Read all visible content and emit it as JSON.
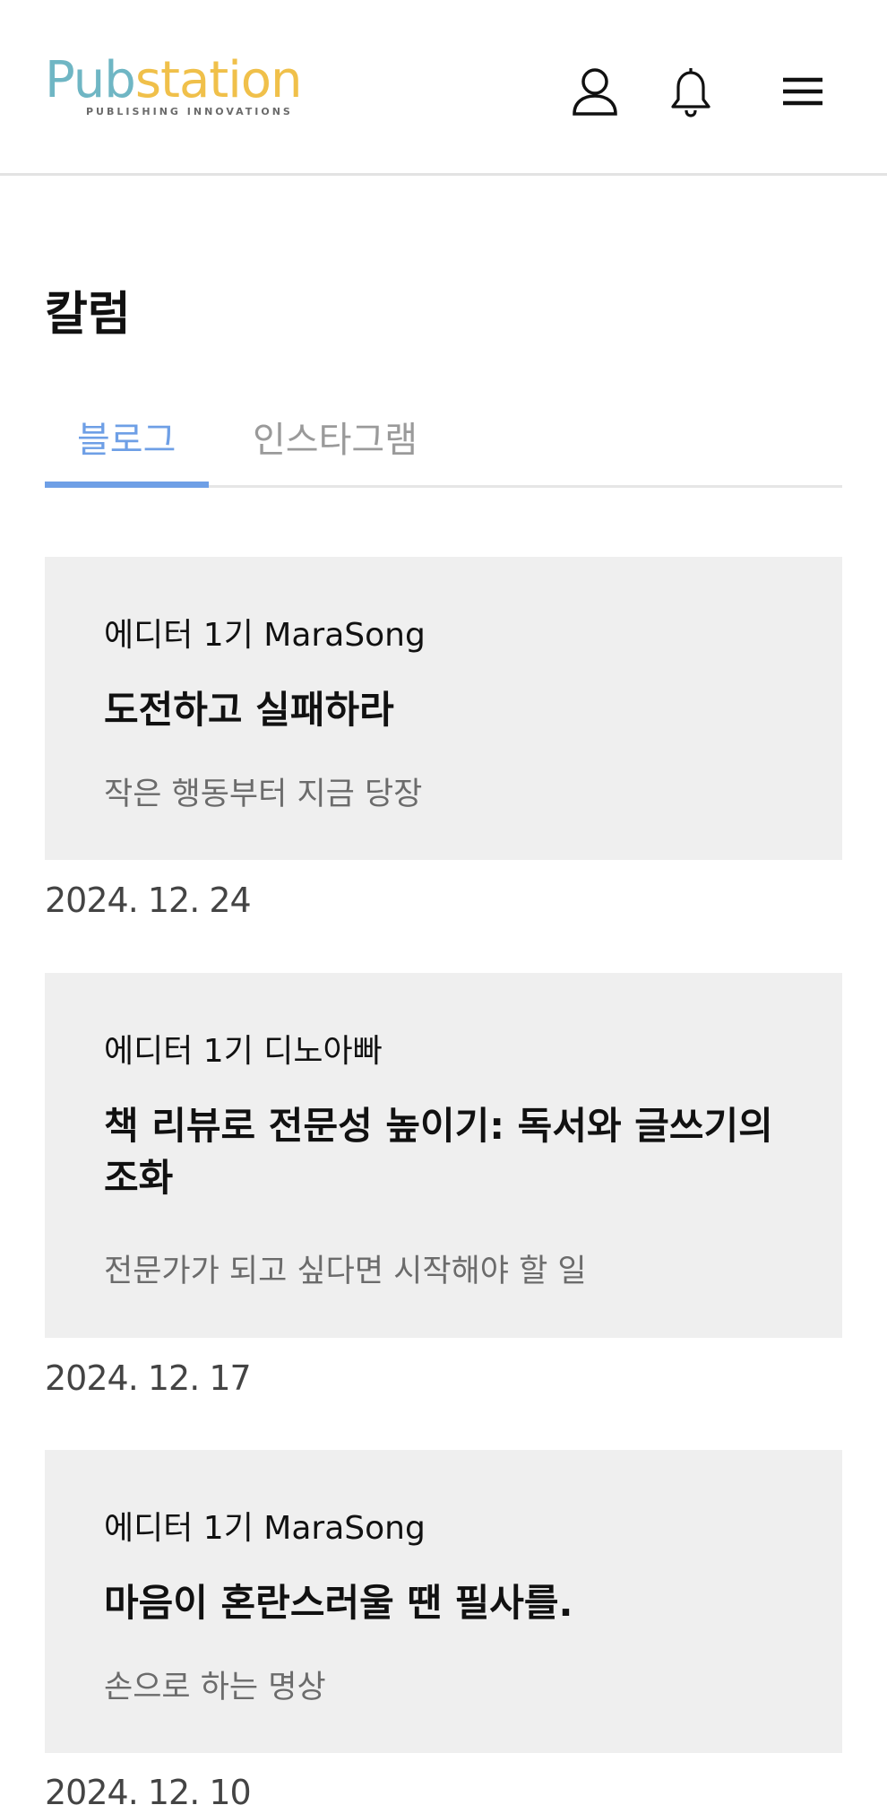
{
  "header": {
    "logo_text_part1": "Pub",
    "logo_text_part2": "station",
    "logo_tagline": "PUBLISHING INNOVATIONS",
    "icons": [
      "user-icon",
      "bell-icon",
      "hamburger-menu-icon"
    ]
  },
  "page": {
    "title": "칼럼"
  },
  "tabs": [
    {
      "label": "블로그",
      "active": true
    },
    {
      "label": "인스타그램",
      "active": false
    }
  ],
  "posts": [
    {
      "author": "에디터 1기  MaraSong",
      "title": "도전하고 실패하라",
      "subtitle": "작은 행동부터 지금 당장",
      "date": "2024. 12. 24"
    },
    {
      "author": "에디터 1기  디노아빠",
      "title": "책 리뷰로 전문성 높이기: 독서와 글쓰기의 조화",
      "subtitle": "전문가가 되고 싶다면 시작해야 할 일",
      "date": "2024. 12. 17"
    },
    {
      "author": "에디터 1기  MaraSong",
      "title": "마음이 혼란스러울 땐 필사를.",
      "subtitle": "손으로 하는 명상",
      "date": "2024. 12. 10"
    }
  ],
  "colors": {
    "accent": "#6e9fe6",
    "card_bg": "#efefef",
    "logo_teal": "#6fb6c4",
    "logo_yellow": "#f0c04a"
  }
}
